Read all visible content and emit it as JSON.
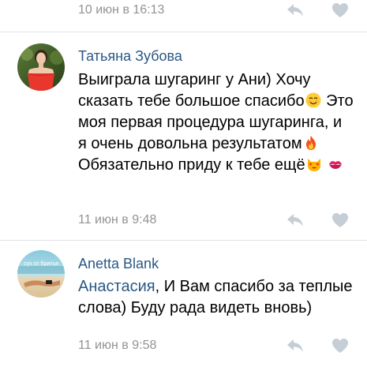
{
  "comments": [
    {
      "timestamp": "10 июн в 16:13"
    },
    {
      "author": "Татьяна Зубова",
      "text_part1": "Выиграла шугаринг у Ани) Хочу сказать тебе большое спасибо",
      "text_part2": "Это моя первая процедура шугаринга, и я очень довольна результатом",
      "text_part3": "Обязательно приду к тебе ещё",
      "timestamp": "11 июн в 9:48",
      "emojis": [
        "smiling-face-emoji",
        "fire-emoji",
        "heart-eyes-cat-emoji",
        "kiss-mark-emoji"
      ]
    },
    {
      "author": "Anetta Blank",
      "mention": "Анастасия",
      "text": ", И Вам спасибо за теплые слова) Буду рада видеть вновь)",
      "timestamp": "11 июн в 9:58",
      "avatar_caption": "сух от бритья"
    }
  ],
  "colors": {
    "link": "#2a5885",
    "meta": "#939393",
    "icon": "#c5cdd5",
    "divider": "#dfe3e8"
  }
}
